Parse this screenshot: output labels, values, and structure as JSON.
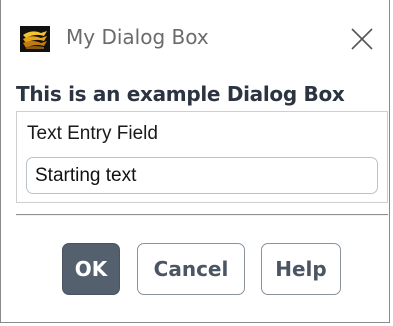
{
  "window": {
    "title": "My Dialog Box",
    "icon": "app-logo-icon",
    "close_icon": "close-icon"
  },
  "content": {
    "heading": "This is an example Dialog Box",
    "field_label": "Text Entry Field",
    "field_value": "Starting text"
  },
  "buttons": {
    "ok": "OK",
    "cancel": "Cancel",
    "help": "Help"
  },
  "colors": {
    "ok_button_bg": "#55606e",
    "heading_text": "#2b3440",
    "button_text": "#4b5563"
  }
}
